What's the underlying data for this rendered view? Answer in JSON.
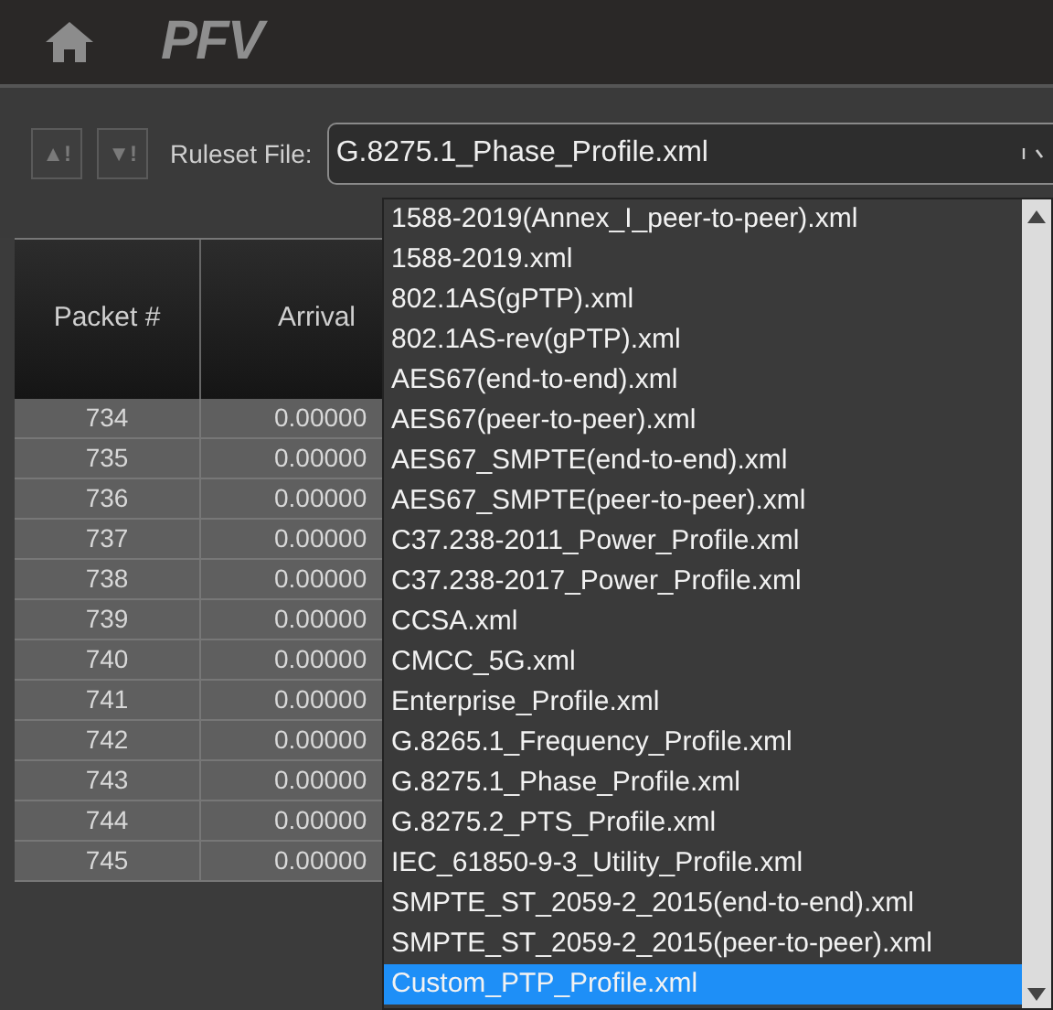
{
  "app_bar": {
    "logo": "PFV"
  },
  "toolbar": {
    "buttons": [
      "▲!",
      "▼!"
    ],
    "ruleset_label": "Ruleset File:",
    "ruleset_value": "G.8275.1_Phase_Profile.xml"
  },
  "table": {
    "columns": [
      "Packet #",
      "Arrival"
    ],
    "rows": [
      [
        "734",
        "0.00000"
      ],
      [
        "735",
        "0.00000"
      ],
      [
        "736",
        "0.00000"
      ],
      [
        "737",
        "0.00000"
      ],
      [
        "738",
        "0.00000"
      ],
      [
        "739",
        "0.00000"
      ],
      [
        "740",
        "0.00000"
      ],
      [
        "741",
        "0.00000"
      ],
      [
        "742",
        "0.00000"
      ],
      [
        "743",
        "0.00000"
      ],
      [
        "744",
        "0.00000"
      ],
      [
        "745",
        "0.00000"
      ]
    ]
  },
  "dropdown": {
    "options": [
      {
        "label": "1588-2019(Annex_I_peer-to-peer).xml",
        "selected": false
      },
      {
        "label": "1588-2019.xml",
        "selected": false
      },
      {
        "label": "802.1AS(gPTP).xml",
        "selected": false
      },
      {
        "label": "802.1AS-rev(gPTP).xml",
        "selected": false
      },
      {
        "label": "AES67(end-to-end).xml",
        "selected": false
      },
      {
        "label": "AES67(peer-to-peer).xml",
        "selected": false
      },
      {
        "label": "AES67_SMPTE(end-to-end).xml",
        "selected": false
      },
      {
        "label": "AES67_SMPTE(peer-to-peer).xml",
        "selected": false
      },
      {
        "label": "C37.238-2011_Power_Profile.xml",
        "selected": false
      },
      {
        "label": "C37.238-2017_Power_Profile.xml",
        "selected": false
      },
      {
        "label": "CCSA.xml",
        "selected": false
      },
      {
        "label": "CMCC_5G.xml",
        "selected": false
      },
      {
        "label": "Enterprise_Profile.xml",
        "selected": false
      },
      {
        "label": "G.8265.1_Frequency_Profile.xml",
        "selected": false
      },
      {
        "label": "G.8275.1_Phase_Profile.xml",
        "selected": false
      },
      {
        "label": "G.8275.2_PTS_Profile.xml",
        "selected": false
      },
      {
        "label": "IEC_61850-9-3_Utility_Profile.xml",
        "selected": false
      },
      {
        "label": "SMPTE_ST_2059-2_2015(end-to-end).xml",
        "selected": false
      },
      {
        "label": "SMPTE_ST_2059-2_2015(peer-to-peer).xml",
        "selected": false
      },
      {
        "label": "Custom_PTP_Profile.xml",
        "selected": true
      }
    ]
  }
}
